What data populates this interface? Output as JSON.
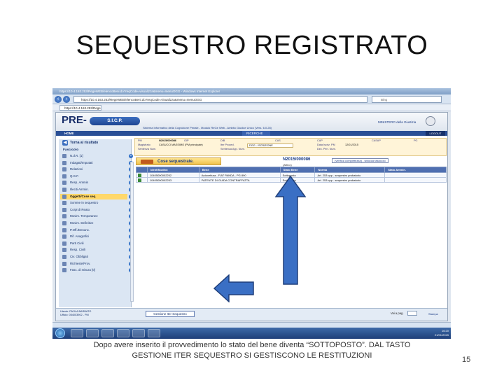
{
  "slide": {
    "title": "SEQUESTRO REGISTRATO",
    "caption_line1": "Dopo avere inserito il provvedimento lo stato del bene diventa “SOTTOPOSTO”.  DAL TASTO",
    "caption_line2": "GESTIONE ITER SEQUESTRO SI GESTISCONO LE RESTITUZIONI",
    "page_number": "15"
  },
  "browser": {
    "window_title": "https://10.4.163.253/RegeWEB/elencoBeni.do?reqCode=visualizza&menu=menuOGG - Windows Internet Explorer",
    "address": "https://10.4.163.253/RegeWEB/elencoBeni.do?reqCode=visualizza&menu=menuOGG",
    "search_placeholder": "Bing",
    "tab_label": "https://10.4.163.253/Rege..."
  },
  "app": {
    "logo_pre": "PRE-",
    "logo_sicp": "S.I.C.P.",
    "subtitle": "Sistema Informativo della Cognizione Penale - Modulo ReGe Web - Ambito Giudice Unico (Vers. 6.0.28)",
    "ministry": "MINISTERO della Giustizia",
    "menu": {
      "home": "HOME",
      "ricerche": "RICERCHE",
      "logout": "LOGOUT"
    },
    "proc_info": {
      "pm_label": "PM",
      "pm_value": "N2015/000086",
      "gip_label": "GIP",
      "dib_label": "DIB",
      "cas_label": "CAS",
      "cap_label": "CAP",
      "casap_label": "CASAP",
      "pg_label": "PG",
      "magistrato_label": "Magistrato",
      "magistrato_value": "CASUCCI MASSIMO (PM principale)",
      "iter_label": "Iter Proced.",
      "iter_value": "DGG - ISCRIZIONE",
      "data_iscr_label": "Data Iscriz. PM",
      "data_iscr_value": "12/01/2015",
      "sentenza_label": "Sentenza Num.",
      "sentenza_app_label": "Sentenza App. Num.",
      "dec_pen_label": "Dec. Pen. Num."
    },
    "sidebar": {
      "back": "Torna al risultato",
      "fascicolo": "Fascicolo",
      "items": [
        {
          "label": "N.d.R. [1]"
        },
        {
          "label": "Indagati/Imputati"
        },
        {
          "label": "Relazioni"
        },
        {
          "label": "Q.G.F."
        },
        {
          "label": "Resp. Ammin"
        },
        {
          "label": "Illeciti Ammin."
        },
        {
          "label": "Oggetti/Cose seq."
        },
        {
          "label": "Somme in sequestro"
        },
        {
          "label": "Corpi di Reato"
        },
        {
          "label": "Movim. Temporanee"
        },
        {
          "label": "Movim. Definitive"
        },
        {
          "label": "P.Off./Denunc."
        },
        {
          "label": "Rif. Anagrafici"
        },
        {
          "label": "Parti Civili"
        },
        {
          "label": "Resp. Civili"
        },
        {
          "label": "Civ. Obbligati"
        },
        {
          "label": "Richieste/Prov."
        },
        {
          "label": "Fasc. di misura [0]"
        }
      ]
    },
    "main": {
      "title": "Cose sequestrate.",
      "proc_number": "N2015/000086",
      "attivo": "(Attivo)",
      "verifica_link": "(verifica completezza) - sblocca fascicolo",
      "table": {
        "headers": [
          "",
          "Identificativo",
          "Bene",
          "Stato Bene",
          "Norma",
          "Stato Ammin."
        ],
        "rows": [
          [
            "",
            "10405000002252",
            "Autovettura - FIAT PANDA - PG 890",
            "Sottoposto",
            "Art. 253 cpp - sequestro probatorio",
            ""
          ],
          [
            "",
            "10405000002253",
            "PATENTE DI GUIDA CONTRAFFATTA",
            "Sottoposto",
            "Art. 253 cpp - sequestro probatorio",
            ""
          ]
        ]
      }
    },
    "footer": {
      "utente_line1": "Utente: PAOLA BARBATO",
      "utente_line2": "Ufficio: 054003902 - PM",
      "gestione_btn": "Gestione Iter Sequestro",
      "vai_label": "Vai a pag.",
      "stampa": "Stampa"
    },
    "taskbar": {
      "time": "16:20",
      "date": "21/01/2015"
    }
  },
  "colors": {
    "arrow_fill": "#3a6fc4",
    "arrow_stroke": "#1f3f7a",
    "header_blue": "#2a4f96"
  }
}
